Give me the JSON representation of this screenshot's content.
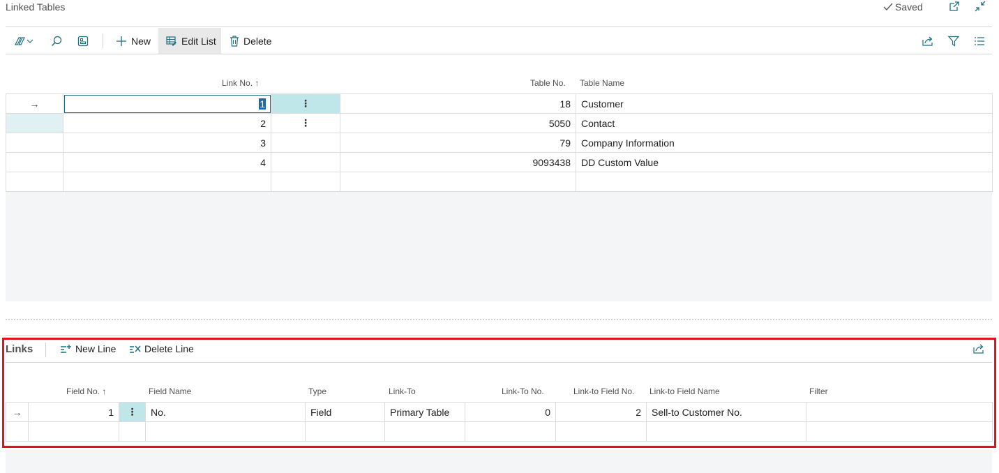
{
  "page": {
    "title": "Linked Tables",
    "status": "Saved"
  },
  "toolbar": {
    "new_label": "New",
    "edit_list_label": "Edit List",
    "delete_label": "Delete"
  },
  "main_table": {
    "headers": {
      "link_no": "Link No. ↑",
      "table_no": "Table No.",
      "table_name": "Table Name"
    },
    "rows": [
      {
        "link_no": "1",
        "table_no": "18",
        "table_name": "Customer"
      },
      {
        "link_no": "2",
        "table_no": "5050",
        "table_name": "Contact"
      },
      {
        "link_no": "3",
        "table_no": "79",
        "table_name": "Company Information"
      },
      {
        "link_no": "4",
        "table_no": "9093438",
        "table_name": "DD Custom Value"
      }
    ]
  },
  "links": {
    "title": "Links",
    "new_line_label": "New Line",
    "delete_line_label": "Delete Line",
    "headers": {
      "field_no": "Field No. ↑",
      "field_name": "Field Name",
      "type": "Type",
      "link_to": "Link-To",
      "link_to_no": "Link-To No.",
      "link_to_field_no": "Link-to Field No.",
      "link_to_field_name": "Link-to Field Name",
      "filter": "Filter"
    },
    "rows": [
      {
        "field_no": "1",
        "field_name": "No.",
        "type": "Field",
        "link_to": "Primary Table",
        "link_to_no": "0",
        "link_to_field_no": "2",
        "link_to_field_name": "Sell-to Customer No.",
        "filter": ""
      }
    ]
  },
  "icons": {
    "row_arrow": "→",
    "row_menu": "⋮"
  },
  "colors": {
    "accent": "#1e6e80",
    "highlight_box": "#e0121b",
    "selection": "#bfe7ea"
  }
}
